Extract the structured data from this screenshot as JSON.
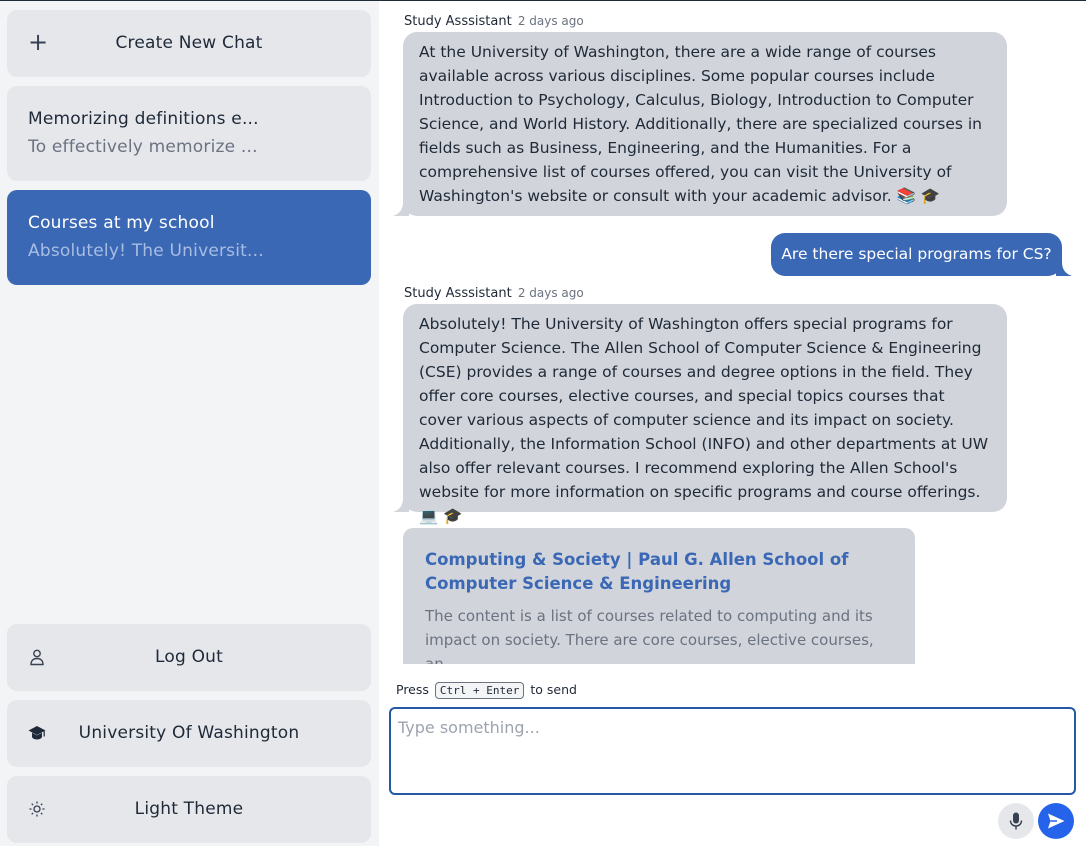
{
  "sidebar": {
    "create_label": "Create New Chat",
    "chats": [
      {
        "title": "Memorizing definitions e...",
        "preview": "To effectively memorize ..."
      },
      {
        "title": "Courses at my school",
        "preview": "Absolutely! The Universit..."
      }
    ],
    "logout_label": "Log Out",
    "school_label": "University Of Washington",
    "theme_label": "Light Theme"
  },
  "messages": [
    {
      "sender": "Study Asssistant",
      "time": "2 days ago",
      "text": "At the University of Washington, there are a wide range of courses available across various disciplines. Some popular courses include Introduction to Psychology, Calculus, Biology, Introduction to Computer Science, and World History. Additionally, there are specialized courses in fields such as Business, Engineering, and the Humanities. For a comprehensive list of courses offered, you can visit the University of Washington's website or consult with your academic advisor. 📚 🎓"
    },
    {
      "user_text": "Are there special programs for CS?"
    },
    {
      "sender": "Study Asssistant",
      "time": "2 days ago",
      "text": "Absolutely! The University of Washington offers special programs for Computer Science. The Allen School of Computer Science & Engineering (CSE) provides a range of courses and degree options in the field. They offer core courses, elective courses, and special topics courses that cover various aspects of computer science and its impact on society. Additionally, the Information School (INFO) and other departments at UW also offer relevant courses. I recommend exploring the Allen School's website for more information on specific programs and course offerings. 💻 🎓"
    }
  ],
  "link_card": {
    "title": "Computing & Society | Paul G. Allen School of Computer Science & Engineering",
    "description": "The content is a list of courses related to computing and its impact on society. There are core courses, elective courses, an..."
  },
  "composer": {
    "hint_prefix": "Press",
    "shortcut": "Ctrl + Enter",
    "hint_suffix": "to send",
    "placeholder": "Type something..."
  },
  "colors": {
    "accent": "#3b68b5",
    "send_button": "#2563eb",
    "bubble": "#d1d5db",
    "sidebar_bg": "#f3f4f6"
  },
  "icons": {
    "create": "plus-icon",
    "logout": "user-icon",
    "school": "graduation-cap-icon",
    "theme": "sun-icon",
    "mic": "microphone-icon",
    "send": "send-icon"
  }
}
